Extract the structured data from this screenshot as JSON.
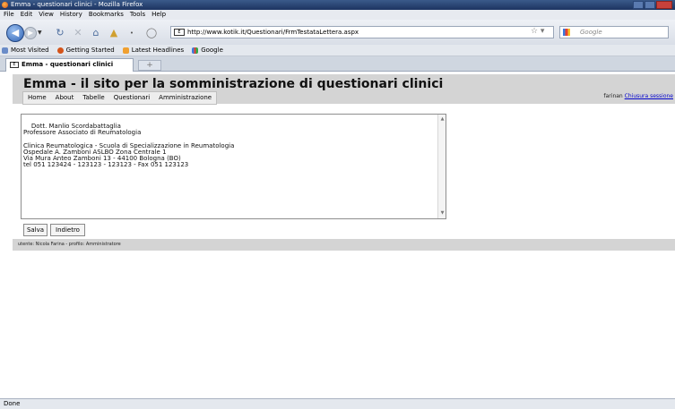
{
  "window": {
    "title": "Emma - questionari clinici - Mozilla Firefox"
  },
  "menu": [
    "File",
    "Edit",
    "View",
    "History",
    "Bookmarks",
    "Tools",
    "Help"
  ],
  "navigation": {
    "url": "http://www.kotik.it/Questionari/FrmTestataLettera.aspx",
    "search_placeholder": "Google"
  },
  "bookmarks": [
    "Most Visited",
    "Getting Started",
    "Latest Headlines",
    "Google"
  ],
  "tab": {
    "title": "Emma - questionari clinici",
    "new_tab": "+"
  },
  "site": {
    "title": "Emma - il sito per la somministrazione di questionari clinici",
    "nav": [
      "Home",
      "About",
      "Tabelle",
      "Questionari",
      "Amministrazione"
    ],
    "user": "farinan",
    "logout": "Chiusura sessione"
  },
  "letter_text": "Dott. Manlio Scordabattaglia\nProfessore Associato di Reumatologia\n\nClinica Reumatologica - Scuola di Specializzazione in Reumatologia\nOspedale A. Zamboni ASLBO Zona Centrale 1\nVia Mura Anteo Zamboni 13 - 44100 Bologna (BO)\ntel 051 123424 - 123123 - 123123 - Fax 051 123123",
  "buttons": {
    "save": "Salva",
    "back": "Indietro"
  },
  "footer": "utente: Nicola Farina - profilo: Amministratore",
  "status": "Done"
}
